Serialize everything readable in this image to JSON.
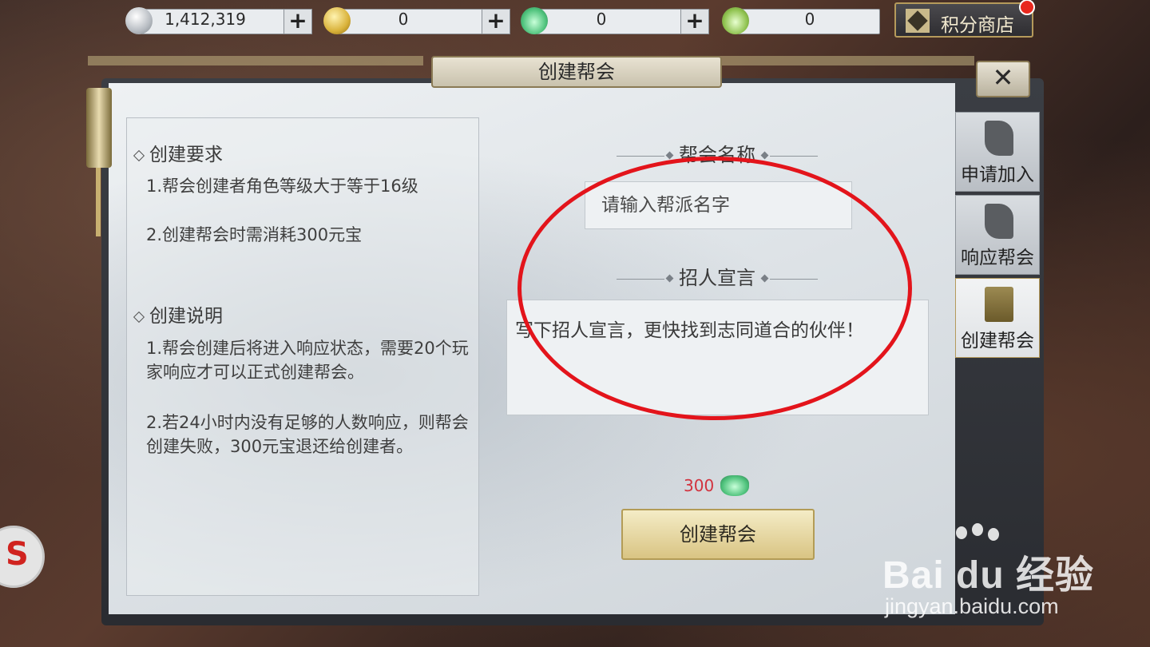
{
  "currencies": [
    {
      "name": "silver-coin",
      "value": "1,412,319",
      "has_plus": true
    },
    {
      "name": "gold-coin",
      "value": "0",
      "has_plus": true
    },
    {
      "name": "green-ingot",
      "value": "0",
      "has_plus": true
    },
    {
      "name": "locked-ingot",
      "value": "0",
      "has_plus": false
    }
  ],
  "plus_label": "+",
  "shop": {
    "label": "积分商店"
  },
  "dialog": {
    "title": "创建帮会",
    "close_label": "✕"
  },
  "requirements": {
    "heading": "创建要求",
    "items": [
      "1.帮会创建者角色等级大于等于16级",
      "2.创建帮会时需消耗300元宝"
    ]
  },
  "instructions": {
    "heading": "创建说明",
    "items": [
      "1.帮会创建后将进入响应状态，需要20个玩家响应才可以正式创建帮会。",
      "2.若24小时内没有足够的人数响应，则帮会创建失败，300元宝退还给创建者。"
    ]
  },
  "form": {
    "name_label": "帮会名称",
    "name_placeholder": "请输入帮派名字",
    "decl_label": "招人宣言",
    "decl_placeholder": "写下招人宣言，更快找到志同道合的伙伴！",
    "cost": "300",
    "submit_label": "创建帮会"
  },
  "tabs": [
    {
      "label": "申请加入",
      "active": false
    },
    {
      "label": "响应帮会",
      "active": false
    },
    {
      "label": "创建帮会",
      "active": true
    }
  ],
  "watermark": {
    "brand": "Bai du 经验",
    "url": "jingyan.baidu.com"
  },
  "colors": {
    "annotation": "#e3141b",
    "cost": "#d2323e",
    "button": "#e8d9a0"
  }
}
